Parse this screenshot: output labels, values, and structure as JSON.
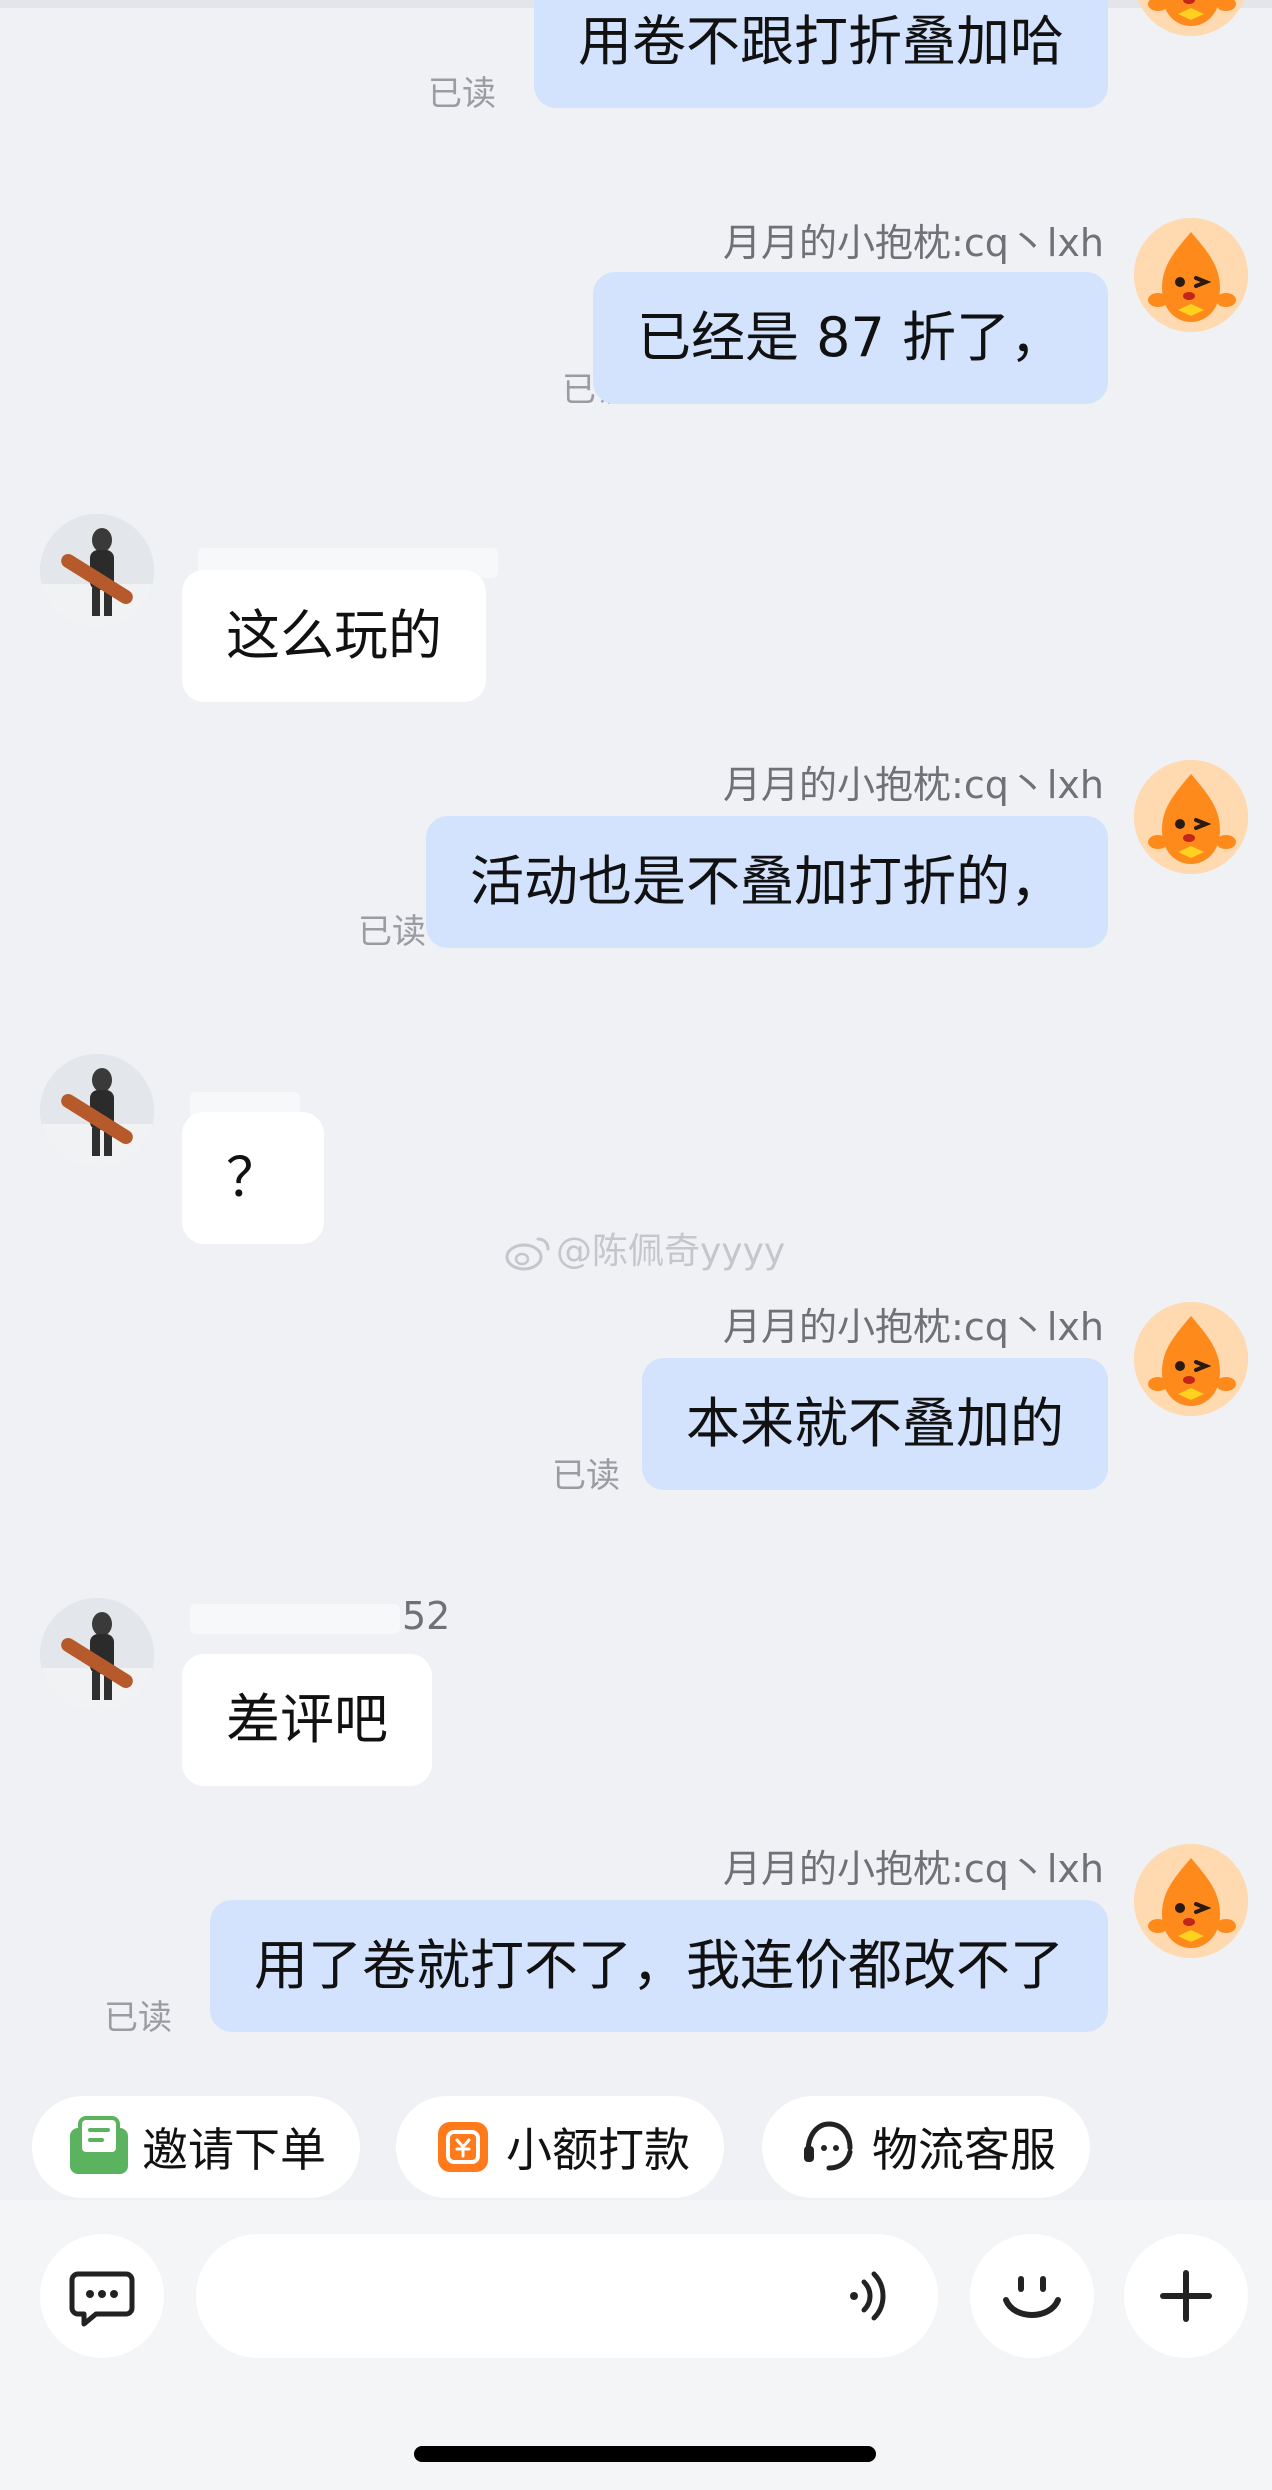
{
  "shop_name": "月月的小抱枕:cq丶lxh",
  "read_label": "已读",
  "watermark": "@陈佩奇yyyy",
  "partial_user_name": "52",
  "messages": [
    {
      "dir": "out",
      "text": "用卷不跟打折叠加哈"
    },
    {
      "dir": "out",
      "text": "已经是 87 折了，"
    },
    {
      "dir": "in",
      "text": "这么玩的"
    },
    {
      "dir": "out",
      "text": "活动也是不叠加打折的，"
    },
    {
      "dir": "in",
      "text": "？"
    },
    {
      "dir": "out",
      "text": "本来就不叠加的"
    },
    {
      "dir": "in",
      "text": "差评吧"
    },
    {
      "dir": "out",
      "text": "用了卷就打不了，我连价都改不了"
    }
  ],
  "quick_actions": [
    {
      "label": "邀请下单",
      "icon": "invite-order-icon",
      "color": "#5cb35f"
    },
    {
      "label": "小额打款",
      "icon": "small-payment-icon",
      "color": "#ff7a1a"
    },
    {
      "label": "物流客服",
      "icon": "logistics-service-icon",
      "color": "#222222"
    }
  ],
  "colors": {
    "background": "#eff1f5",
    "outgoing_bubble": "#d3e2fd",
    "incoming_bubble": "#ffffff",
    "read_text": "#9a9ca2"
  }
}
